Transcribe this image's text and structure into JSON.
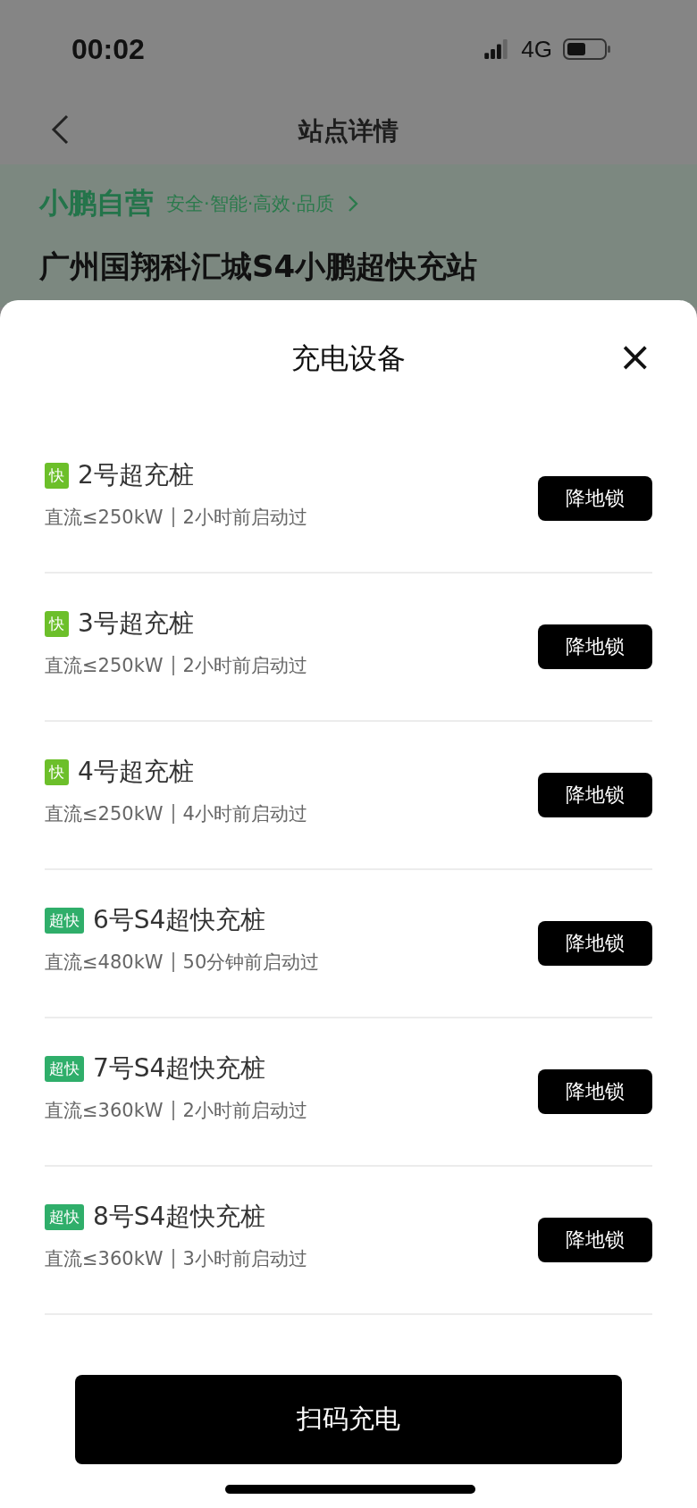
{
  "status_bar": {
    "time": "00:02",
    "network": "4G"
  },
  "nav": {
    "title": "站点详情"
  },
  "station": {
    "brand": "小鹏自营",
    "slogan": "安全·智能·高效·品质",
    "name": "广州国翔科汇城S4小鹏超快充站"
  },
  "sheet": {
    "title": "充电设备",
    "close": "×",
    "chargers": [
      {
        "badge": "快",
        "kind": "fast",
        "name": "2号超充桩",
        "power": "直流≤250kW",
        "last_used": "2小时前启动过",
        "action": "降地锁"
      },
      {
        "badge": "快",
        "kind": "fast",
        "name": "3号超充桩",
        "power": "直流≤250kW",
        "last_used": "2小时前启动过",
        "action": "降地锁"
      },
      {
        "badge": "快",
        "kind": "fast",
        "name": "4号超充桩",
        "power": "直流≤250kW",
        "last_used": "4小时前启动过",
        "action": "降地锁"
      },
      {
        "badge": "超快",
        "kind": "super",
        "name": "6号S4超快充桩",
        "power": "直流≤480kW",
        "last_used": "50分钟前启动过",
        "action": "降地锁"
      },
      {
        "badge": "超快",
        "kind": "super",
        "name": "7号S4超快充桩",
        "power": "直流≤360kW",
        "last_used": "2小时前启动过",
        "action": "降地锁"
      },
      {
        "badge": "超快",
        "kind": "super",
        "name": "8号S4超快充桩",
        "power": "直流≤360kW",
        "last_used": "3小时前启动过",
        "action": "降地锁"
      }
    ],
    "scan_button": "扫码充电"
  }
}
